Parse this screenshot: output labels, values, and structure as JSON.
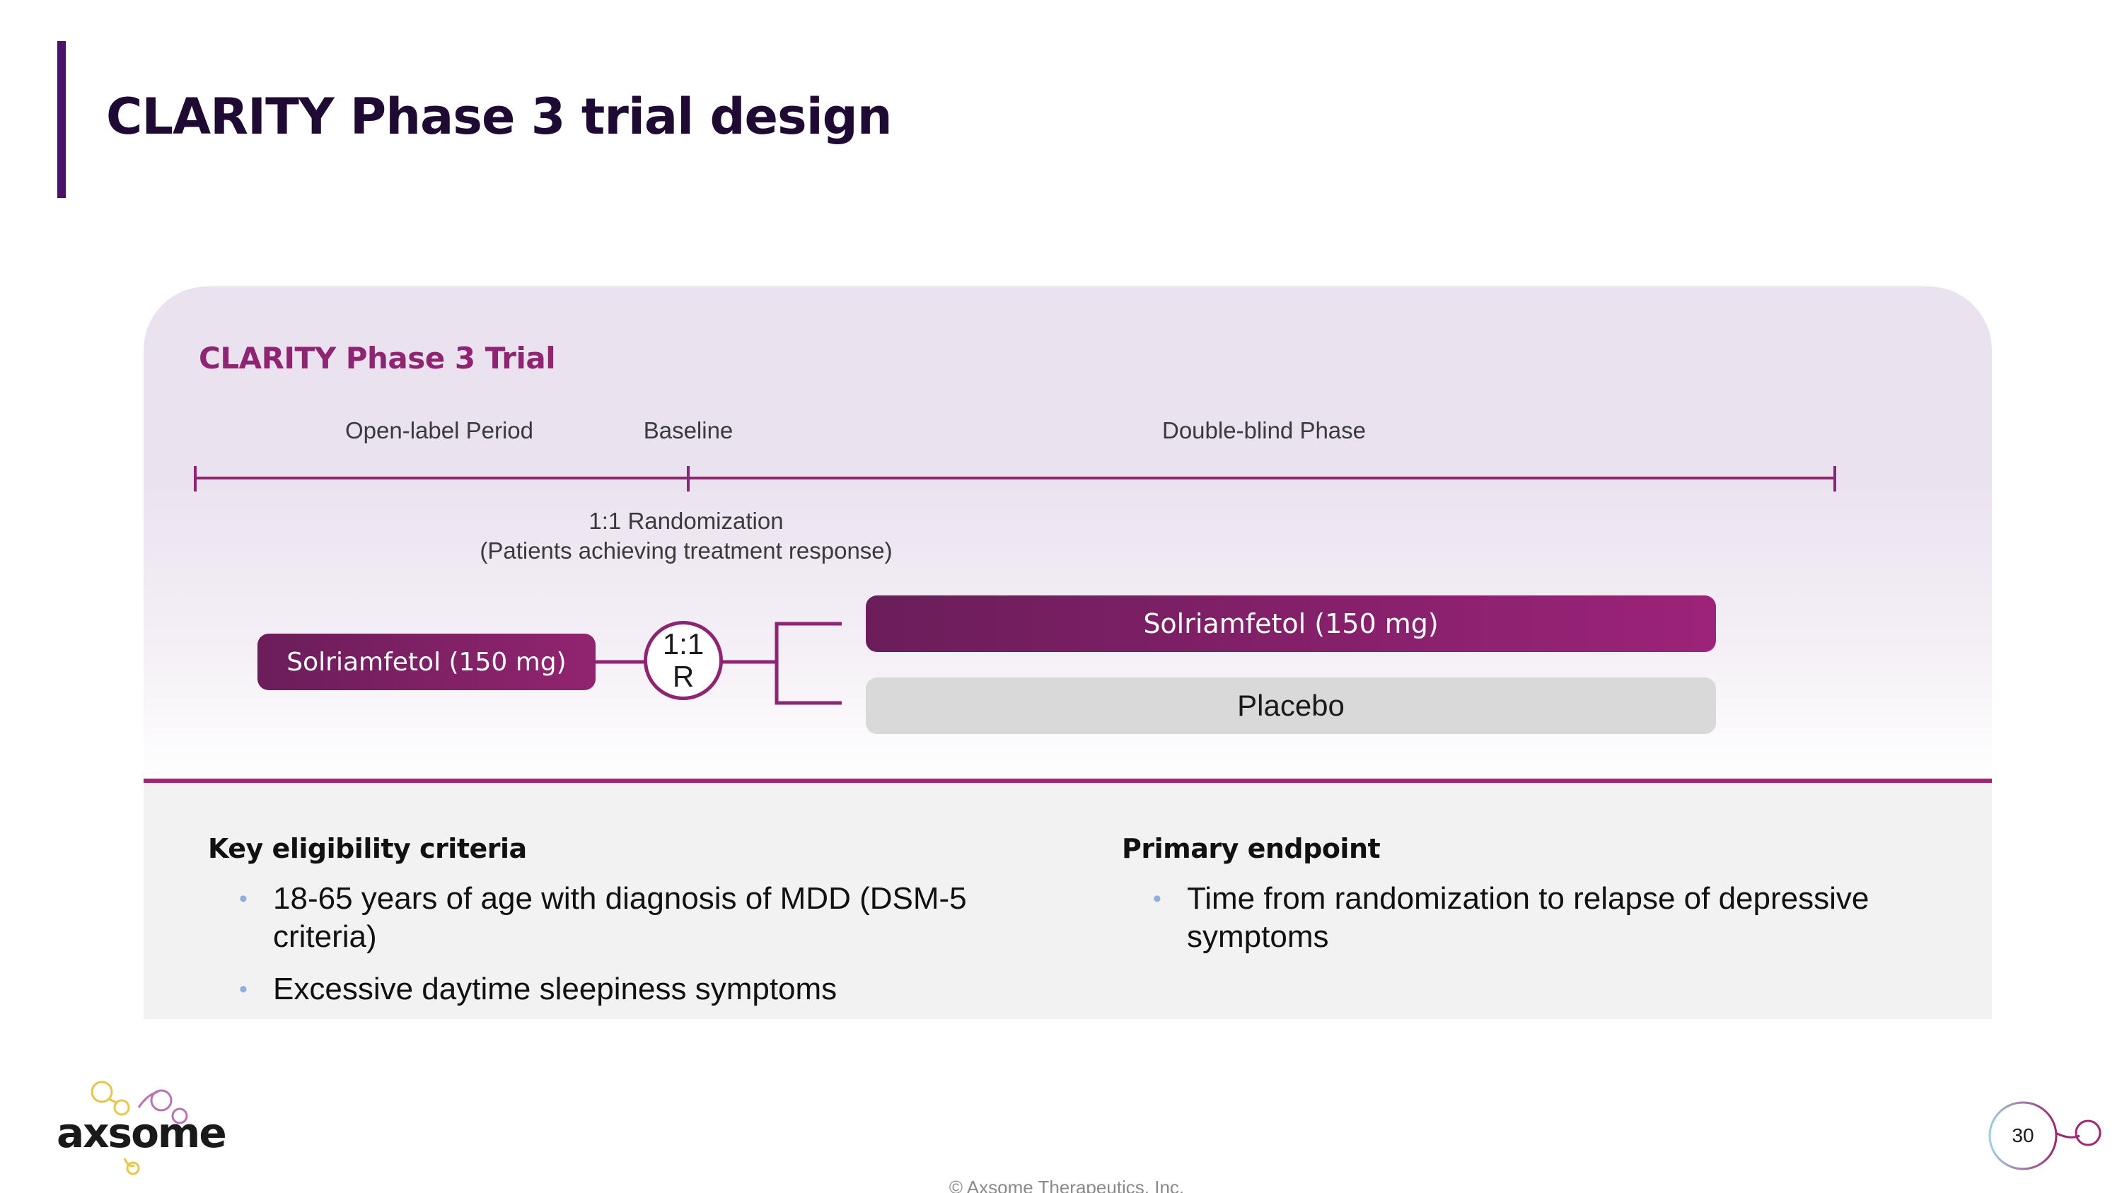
{
  "slide": {
    "title": "CLARITY Phase 3 trial design",
    "page_number": "30",
    "footer": "© Axsome Therapeutics, Inc.",
    "logo_text": "axsome",
    "accent_color": "#4b1366",
    "brand_color": "#8e2472"
  },
  "trial": {
    "title": "CLARITY Phase 3 Trial",
    "phases": {
      "open_label": "Open-label Period",
      "baseline": "Baseline",
      "double_blind": "Double-blind Phase"
    },
    "randomization_note": {
      "line1": "1:1 Randomization",
      "line2": "(Patients achieving treatment response)"
    },
    "open_label_arm": "Solriamfetol (150 mg)",
    "randomization_symbol": {
      "ratio": "1:1",
      "letter": "R"
    },
    "arms": {
      "drug": "Solriamfetol (150 mg)",
      "placebo": "Placebo"
    }
  },
  "criteria": {
    "eligibility": {
      "heading": "Key eligibility criteria",
      "items": [
        "18-65 years of age with diagnosis of MDD (DSM-5 criteria)",
        "Excessive daytime sleepiness symptoms"
      ]
    },
    "endpoint": {
      "heading": "Primary endpoint",
      "items": [
        "Time from randomization to relapse of depressive symptoms"
      ]
    }
  }
}
